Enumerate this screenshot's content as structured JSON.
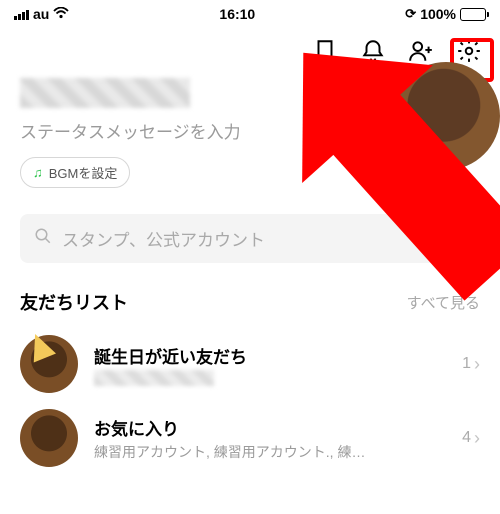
{
  "status_bar": {
    "carrier": "au",
    "time": "16:10",
    "battery_pct": "100%"
  },
  "profile": {
    "status_placeholder": "ステータスメッセージを入力",
    "bgm_label": "BGMを設定"
  },
  "search": {
    "placeholder": "スタンプ、公式アカウント"
  },
  "friends": {
    "title": "友だちリスト",
    "see_all": "すべて見る",
    "rows": [
      {
        "title": "誕生日が近い友だち",
        "sub": "",
        "count": "1"
      },
      {
        "title": "お気に入り",
        "sub": "練習用アカウント, 練習用アカウント., 練…",
        "count": "4"
      }
    ]
  }
}
